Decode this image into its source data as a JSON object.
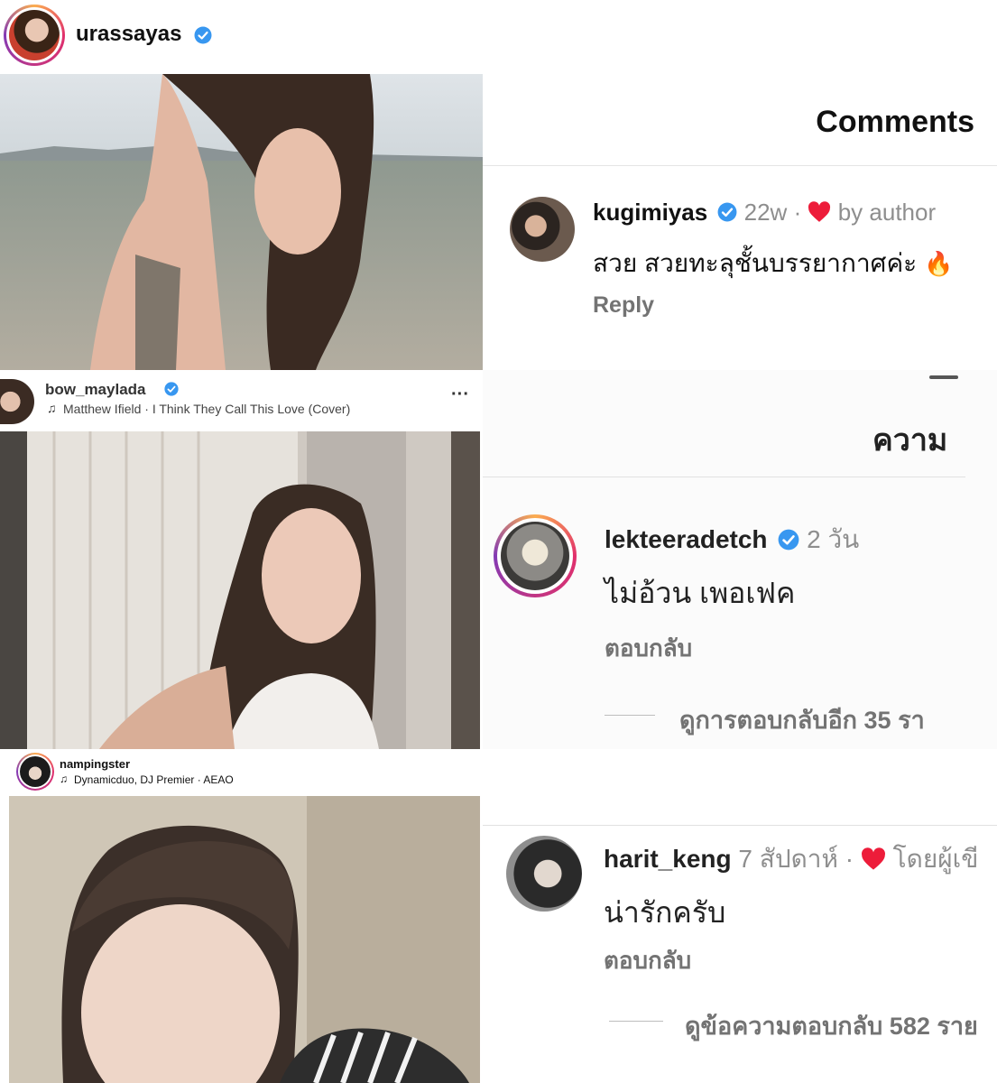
{
  "panel1": {
    "username": "urassayas",
    "comments_title": "Comments",
    "comment": {
      "username": "kugimiyas",
      "time": "22w",
      "dot": "·",
      "by_author": "by author",
      "text": "สวย สวยทะลุชั้นบรรยากาศค่ะ",
      "reply": "Reply"
    }
  },
  "panel2": {
    "username": "bow_maylada",
    "music": "Matthew Ifield · I Think They Call This Love (Cover)",
    "more": "···",
    "comments_title": "ความ",
    "comment": {
      "username": "lekteeradetch",
      "time": "2 วัน",
      "text": "ไม่อ้วน เพอเฟค",
      "reply": "ตอบกลับ",
      "view_replies": "ดูการตอบกลับอีก 35 รา"
    }
  },
  "panel3": {
    "username": "nampingster",
    "music": "Dynamicduo, DJ Premier · AEAO",
    "comment": {
      "username": "harit_keng",
      "time": "7 สัปดาห์",
      "dot": "·",
      "by_author": "โดยผู้เขี",
      "text": "น่ารักครับ",
      "reply": "ตอบกลับ",
      "view_replies": "ดูข้อความตอบกลับ 582 ราย"
    }
  },
  "colors": {
    "verified": "#3897f0",
    "heart": "#ed1c3a",
    "muted": "#8e8e8e"
  }
}
